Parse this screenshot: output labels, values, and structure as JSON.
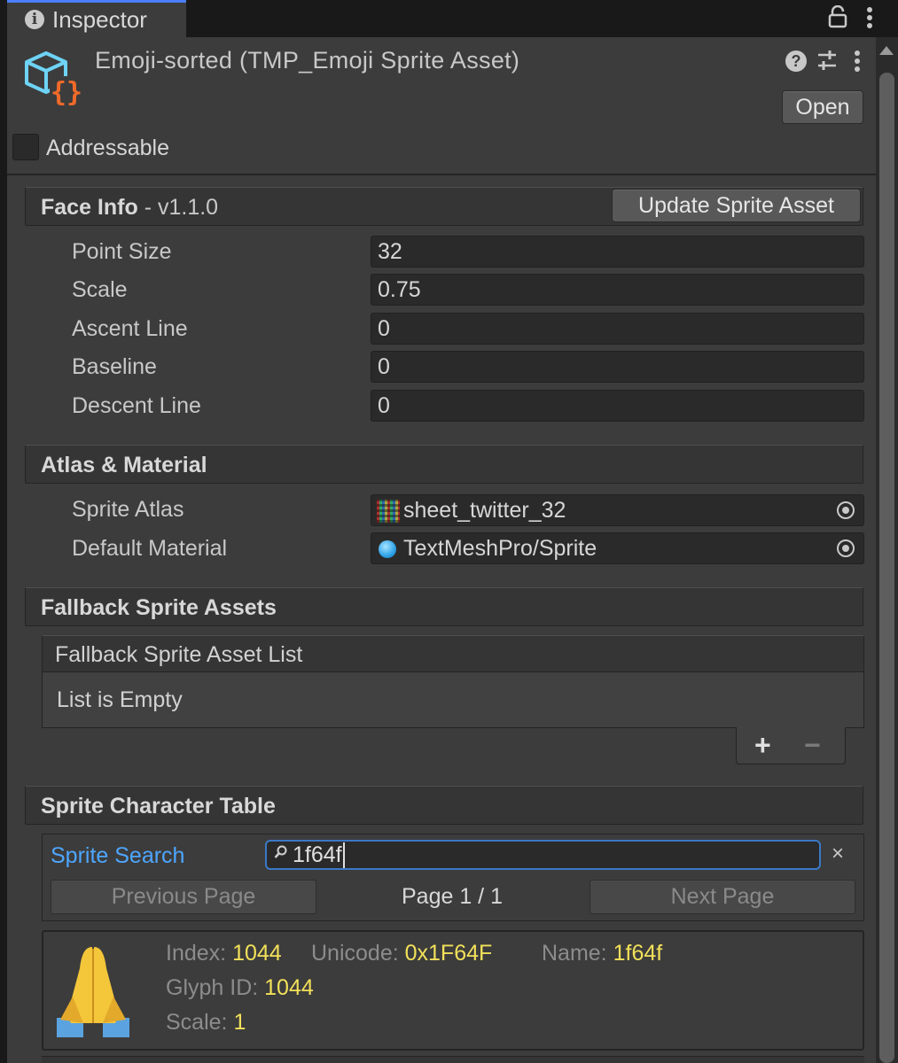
{
  "window": {
    "tab_label": "Inspector"
  },
  "asset": {
    "title": "Emoji-sorted (TMP_Emoji Sprite Asset)",
    "open_label": "Open",
    "addressable_label": "Addressable",
    "addressable_checked": false
  },
  "face_info": {
    "title": "Face Info",
    "version": " - v1.1.0",
    "update_label": "Update Sprite Asset",
    "props": [
      {
        "label": "Point Size",
        "value": "32"
      },
      {
        "label": "Scale",
        "value": "0.75"
      },
      {
        "label": "Ascent Line",
        "value": "0"
      },
      {
        "label": "Baseline",
        "value": "0"
      },
      {
        "label": "Descent Line",
        "value": "0"
      }
    ]
  },
  "atlas_material": {
    "title": "Atlas & Material",
    "sprite_atlas_label": "Sprite Atlas",
    "sprite_atlas_value": "sheet_twitter_32",
    "default_material_label": "Default Material",
    "default_material_value": "TextMeshPro/Sprite"
  },
  "fallback": {
    "title": "Fallback Sprite Assets",
    "list_title": "Fallback Sprite Asset List",
    "empty_text": "List is Empty",
    "add_symbol": "+",
    "remove_symbol": "−"
  },
  "sprite_table": {
    "title": "Sprite Character Table",
    "search_label": "Sprite Search",
    "search_value": "1f64f",
    "clear_symbol": "×",
    "prev_label": "Previous Page",
    "next_label": "Next Page",
    "page_info": "Page 1 / 1",
    "entry": {
      "index_key": "Index: ",
      "index_val": "1044",
      "unicode_key": "Unicode: ",
      "unicode_val": "0x1F64F",
      "name_key": "Name: ",
      "name_val": "1f64f",
      "glyph_key": "Glyph ID: ",
      "glyph_val": "1044",
      "scale_key": "Scale: ",
      "scale_val": "1"
    }
  },
  "colors": {
    "panel_bg": "#3c3c3c",
    "accent_blue": "#4ea6ff",
    "value_yellow": "#f2e05a",
    "icon_orange": "#f06a2a",
    "icon_cyan": "#6ed3f5"
  },
  "icons": {
    "tab": "info-icon",
    "lock": "lock-icon",
    "menu": "kebab-menu-icon",
    "help": "help-icon",
    "presets": "sliders-icon",
    "asset": "sprite-asset-icon",
    "picker": "object-picker-icon",
    "search": "search-icon"
  }
}
